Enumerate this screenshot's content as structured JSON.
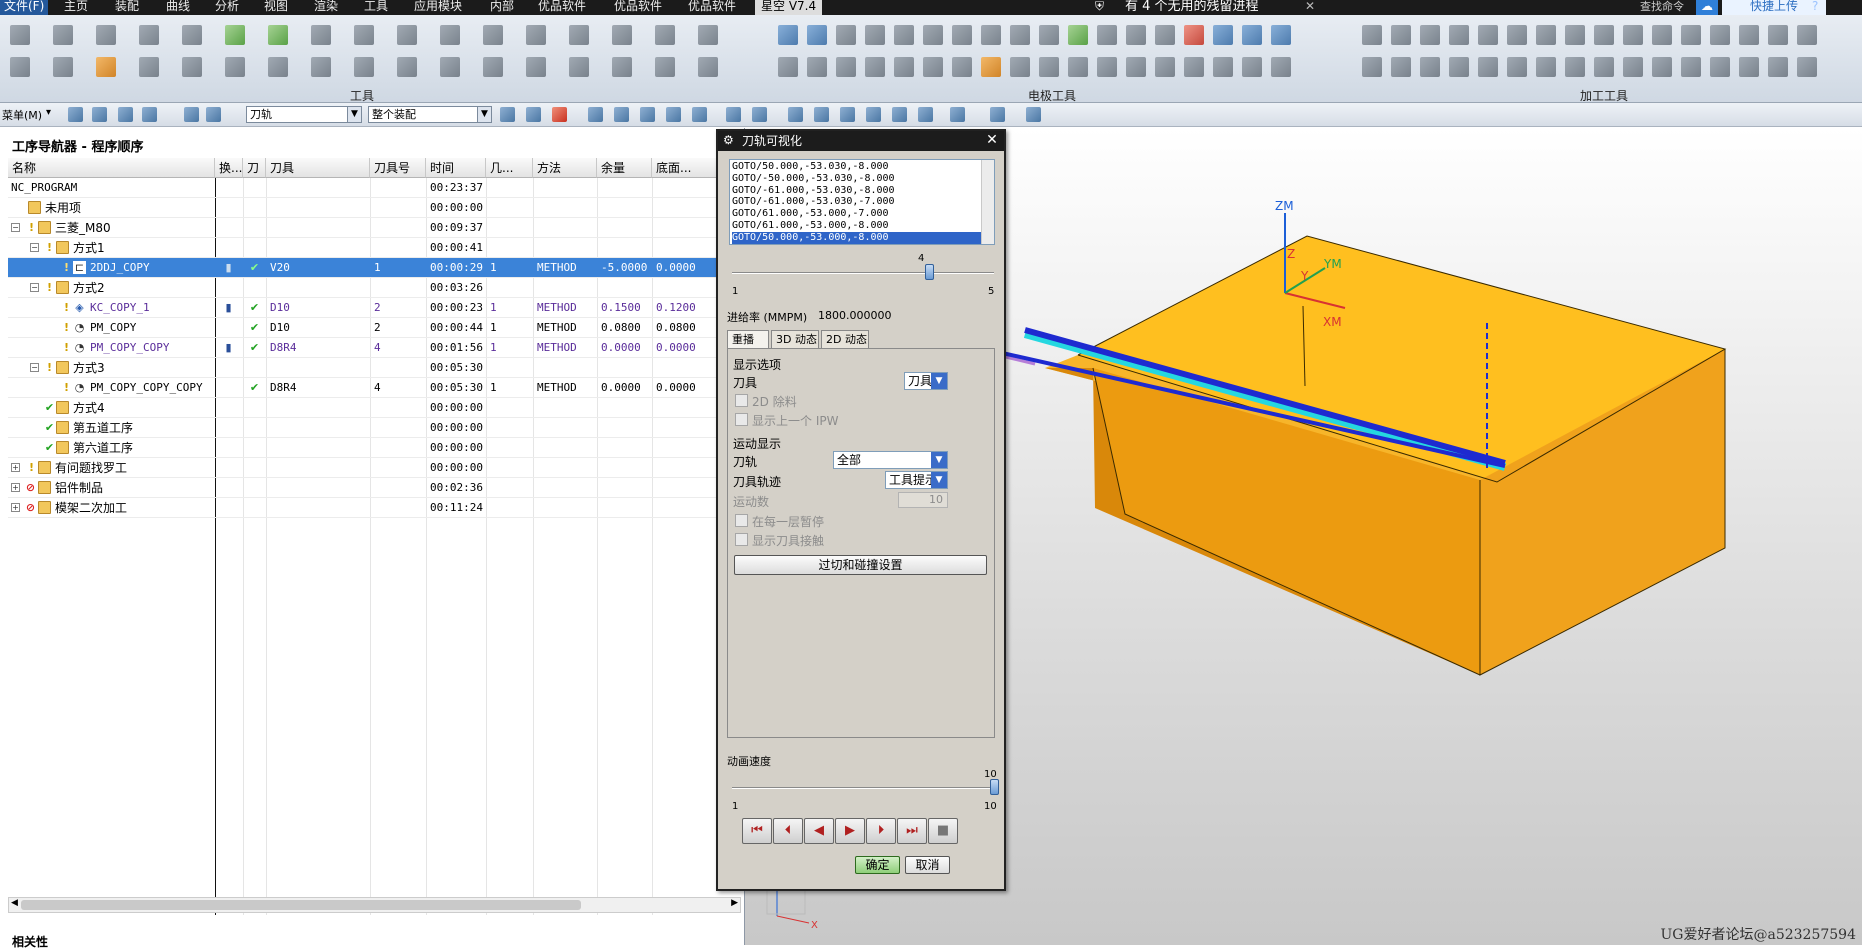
{
  "menubar": {
    "items": [
      "文件(F)",
      "主页",
      "装配",
      "曲线",
      "分析",
      "视图",
      "渲染",
      "工具",
      "应用模块",
      "内部",
      "优品软件",
      "优品软件",
      "优品软件",
      "星空 V7.4"
    ],
    "notification": "有 4 个无用的残留进程",
    "upload": "快捷上传",
    "search_placeholder": "查找命令"
  },
  "ribbon": {
    "groups": [
      "工具",
      "电极工具",
      "加工工具"
    ]
  },
  "toolbar2": {
    "menu_label": "菜单(M)",
    "filter_combo": "刀轨",
    "assembly_combo": "整个装配"
  },
  "navigator": {
    "title": "工序导航器 - 程序顺序",
    "columns": [
      "名称",
      "换...",
      "刀",
      "刀具",
      "刀具号",
      "时间",
      "几...",
      "方法",
      "余量",
      "底面..."
    ],
    "rows": [
      {
        "name": "NC_PROGRAM",
        "time": "00:23:37"
      },
      {
        "name": "未用项",
        "time": "00:00:00"
      },
      {
        "name": "三菱_M80",
        "time": "00:09:37"
      },
      {
        "name": "方式1",
        "time": "00:00:41"
      },
      {
        "name": "2DDJ_COPY",
        "tool": "V20",
        "toolno": "1",
        "time": "00:00:29",
        "geom": "1",
        "method": "METHOD",
        "stock": "-5.0000",
        "floor": "0.0000"
      },
      {
        "name": "方式2",
        "time": "00:03:26"
      },
      {
        "name": "KC_COPY_1",
        "tool": "D10",
        "toolno": "2",
        "time": "00:00:23",
        "geom": "1",
        "method": "METHOD",
        "stock": "0.1500",
        "floor": "0.1200"
      },
      {
        "name": "PM_COPY",
        "tool": "D10",
        "toolno": "2",
        "time": "00:00:44",
        "geom": "1",
        "method": "METHOD",
        "stock": "0.0800",
        "floor": "0.0800"
      },
      {
        "name": "PM_COPY_COPY",
        "tool": "D8R4",
        "toolno": "4",
        "time": "00:01:56",
        "geom": "1",
        "method": "METHOD",
        "stock": "0.0000",
        "floor": "0.0000"
      },
      {
        "name": "方式3",
        "time": "00:05:30"
      },
      {
        "name": "PM_COPY_COPY_COPY",
        "tool": "D8R4",
        "toolno": "4",
        "time": "00:05:30",
        "geom": "1",
        "method": "METHOD",
        "stock": "0.0000",
        "floor": "0.0000"
      },
      {
        "name": "方式4",
        "time": "00:00:00"
      },
      {
        "name": "第五道工序",
        "time": "00:00:00"
      },
      {
        "name": "第六道工序",
        "time": "00:00:00"
      },
      {
        "name": "有问题找罗工",
        "time": "00:00:00"
      },
      {
        "name": "铝件制品",
        "time": "00:02:36"
      },
      {
        "name": "模架二次加工",
        "time": "00:11:24"
      }
    ],
    "related_label": "相关性"
  },
  "dialog": {
    "title": "刀轨可视化",
    "code_lines": [
      "GOTO/50.000,-53.030,-8.000",
      "GOTO/-50.000,-53.030,-8.000",
      "GOTO/-61.000,-53.030,-8.000",
      "GOTO/-61.000,-53.030,-7.000",
      "GOTO/61.000,-53.000,-7.000",
      "GOTO/61.000,-53.000,-8.000",
      "GOTO/50.000,-53.000,-8.000"
    ],
    "slider": {
      "value": "4",
      "min": "1",
      "max": "5",
      "fraction": 0.75
    },
    "feed_label": "进给率 (MMPM)",
    "feed_value": "1800.000000",
    "tabs": [
      "重播",
      "3D 动态",
      "2D 动态"
    ],
    "display_options": "显示选项",
    "tool_label": "刀具",
    "tool_value": "刀具",
    "chk_2d": "2D 除料",
    "chk_prev_ipw": "显示上一个 IPW",
    "motion_display": "运动显示",
    "path_label": "刀轨",
    "path_value": "全部",
    "trace_label": "刀具轨迹",
    "trace_value": "工具提示",
    "motion_count_label": "运动数",
    "motion_count_value": "10",
    "chk_pause": "在每一层暂停",
    "chk_contact": "显示刀具接触",
    "gouge_button": "过切和碰撞设置",
    "anim_speed": "动画速度",
    "speed_slider": {
      "value": "10",
      "min": "1",
      "max": "10",
      "fraction": 1.0
    },
    "ok": "确定",
    "cancel": "取消"
  },
  "viewport": {
    "axes": {
      "zm": "ZM",
      "z": "Z",
      "ym": "YM",
      "y": "Y",
      "xm": "XM",
      "x": "X"
    },
    "watermark": "UG爱好者论坛@a523257594",
    "colors": {
      "block": "#f0a21c",
      "path": "#1e2ad0",
      "cyan": "#25d7e0"
    }
  }
}
